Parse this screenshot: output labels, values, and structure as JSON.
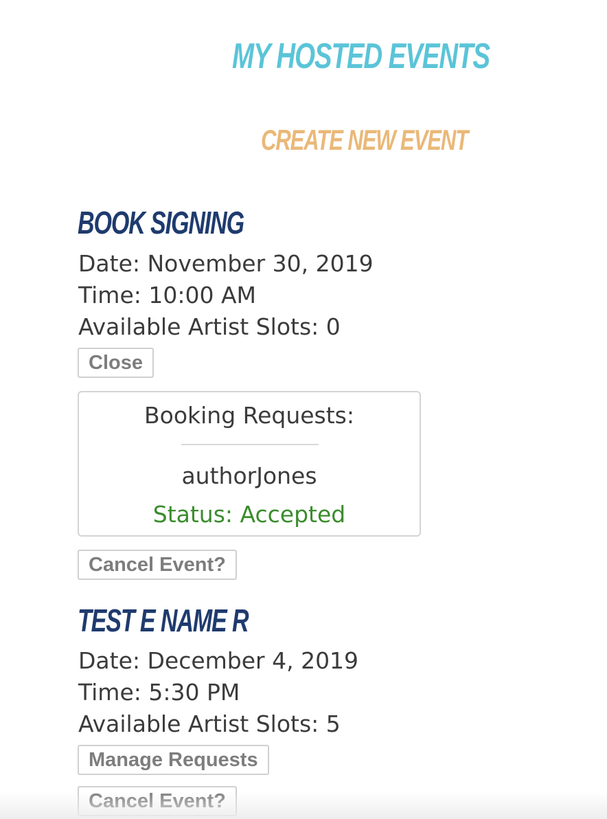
{
  "page": {
    "title": "My Hosted Events",
    "create_link": "Create New Event"
  },
  "events": [
    {
      "name": "Book Signing",
      "date": "Date: November 30, 2019",
      "time": "Time: 10:00 AM",
      "slots": "Available Artist Slots: 0",
      "toggle_label": "Close",
      "booking_requests": {
        "heading": "Booking Requests:",
        "requests": [
          {
            "user": "authorJones",
            "status": "Status: Accepted"
          }
        ]
      },
      "cancel_label": "Cancel Event?"
    },
    {
      "name": "Test E Name R",
      "date": "Date: December 4, 2019",
      "time": "Time: 5:30 PM",
      "slots": "Available Artist Slots: 5",
      "toggle_label": "Manage Requests",
      "cancel_label": "Cancel Event?"
    }
  ],
  "colors": {
    "title": "#5bc4d8",
    "create_link": "#eab878",
    "event_title": "#1f3b6e",
    "status_accepted": "#3a8c2c"
  }
}
